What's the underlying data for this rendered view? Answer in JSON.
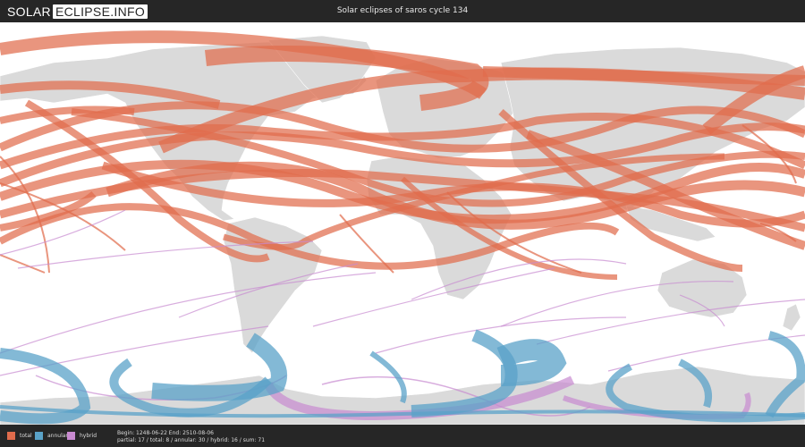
{
  "header": {
    "logo_part1": "SOLAR",
    "logo_part2": "ECLIPSE.INFO",
    "title": "Solar eclipses of saros cycle 134"
  },
  "legend": [
    {
      "label": "total",
      "color": "#e06c4c"
    },
    {
      "label": "annular",
      "color": "#5aa2c8"
    },
    {
      "label": "hybrid",
      "color": "#c88ad0"
    }
  ],
  "stats": {
    "line1": "Begin: 1248-06-22 End: 2510-08-06",
    "line2": "partial: 17 / total: 8 / annular: 30 / hybrid: 16 / sum: 71"
  },
  "colors": {
    "land": "#dadada",
    "header_bg": "#262626"
  }
}
